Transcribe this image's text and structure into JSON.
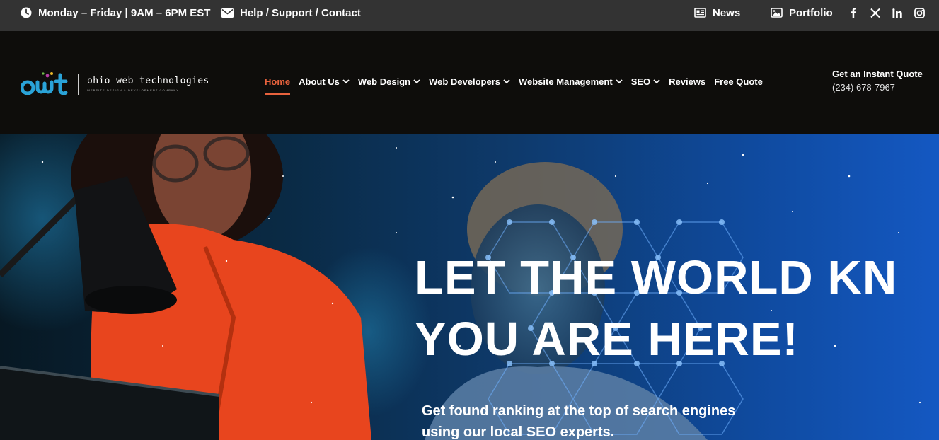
{
  "topbar": {
    "hours": "Monday – Friday | 9AM – 6PM EST",
    "help": "Help / Support / Contact",
    "news": "News",
    "portfolio": "Portfolio",
    "social": [
      "facebook-icon",
      "x-icon",
      "linkedin-icon",
      "instagram-icon"
    ]
  },
  "logo": {
    "mark": "owt",
    "name": "ohio web technologies",
    "tagline": "Website Design & Development Company"
  },
  "nav": {
    "items": [
      {
        "label": "Home",
        "active": true
      },
      {
        "label": "About Us",
        "dropdown": true
      },
      {
        "label": "Web Design",
        "dropdown": true
      },
      {
        "label": "Web Developers",
        "dropdown": true
      },
      {
        "label": "Website Management",
        "dropdown": true
      },
      {
        "label": "SEO",
        "dropdown": true
      },
      {
        "label": "Reviews"
      },
      {
        "label": "Free Quote"
      }
    ]
  },
  "quote": {
    "label": "Get an Instant Quote",
    "phone": "(234) 678-7967"
  },
  "hero": {
    "line1": "LET THE WORLD KN",
    "line2": "YOU ARE HERE!",
    "subtext": "Get found ranking at the top of search engines using our local SEO experts."
  },
  "colors": {
    "accent": "#e8623d",
    "logo_blue": "#2aa3d8",
    "topbar": "#333333",
    "header": "#0e0d0b"
  }
}
